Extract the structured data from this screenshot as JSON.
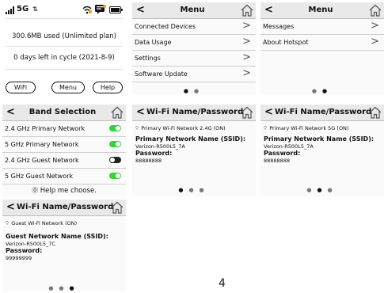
{
  "status_screen": {
    "network": "5G",
    "data_used": "300.6MB used (Unlimited plan)",
    "cycle": "0 days left in cycle (2021-8-9)",
    "buttons": [
      "WiFi",
      "Menu",
      "Help"
    ]
  },
  "menu_screen_1": {
    "title": "Menu",
    "items": [
      "Connected Devices",
      "Data Usage",
      "Settings",
      "Software Update"
    ]
  },
  "menu_screen_2": {
    "title": "Menu",
    "items": [
      "Messages",
      "About Hotspot"
    ]
  },
  "band_screen": {
    "title": "Band Selection",
    "items": [
      {
        "label": "2.4 GHz Primary Network",
        "on": true
      },
      {
        "label": "5 GHz Primary Network",
        "on": true
      },
      {
        "label": "2.4 GHz Guest Network",
        "on": false
      },
      {
        "label": "5 GHz Guest Network",
        "on": true
      }
    ],
    "help": "Help me choose."
  },
  "wifi_screen_1": {
    "title": "Wi-Fi Name/Password",
    "network_label": "Primary Wi-Fi Network 2.4G (ON)",
    "ssid_heading": "Primary Network Name (SSID):",
    "ssid": "Verizon-R500L5_7A",
    "password_heading": "Password:",
    "password": "88888888"
  },
  "wifi_screen_2": {
    "title": "Wi-Fi Name/Password",
    "network_label": "Primary Wi-Fi Network 5G (ON)",
    "ssid_heading": "Primary Network Name (SSID):",
    "ssid": "Verizon-R500L5_7A",
    "password_heading": "Password:",
    "password": "88888888"
  },
  "wifi_screen_3": {
    "title": "Wi-Fi Name/Password",
    "network_label": "Guest Wi-Fi Network (ON)",
    "ssid_heading": "Guest Network Name (SSID):",
    "ssid": "Verizon-R500L5_7C",
    "password_heading": "Password:",
    "password": "99999999"
  },
  "page_number": "4"
}
